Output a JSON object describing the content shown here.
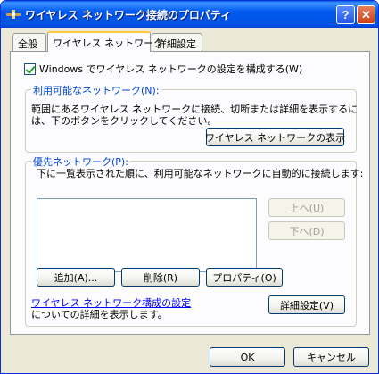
{
  "window": {
    "title": "ワイヤレス ネットワーク接続のプロパティ",
    "help_label": "?",
    "close_label": "✕"
  },
  "tabs": [
    {
      "label": "全般",
      "active": false
    },
    {
      "label": "ワイヤレス ネットワーク",
      "active": true
    },
    {
      "label": "詳細設定",
      "active": false
    }
  ],
  "config_checkbox": {
    "label": "Windows でワイヤレス ネットワークの設定を構成する(W)",
    "checked": true
  },
  "available": {
    "title": "利用可能なネットワーク(N):",
    "description_line1": "範囲にあるワイヤレス ネットワークに接続、切断または詳細を表示するに",
    "description_line2": "は、下のボタンをクリックしてください。",
    "view_button": "ワイヤレス ネットワークの表示"
  },
  "preferred": {
    "title": "優先ネットワーク(P):",
    "description": "下に一覧表示された順に、利用可能なネットワークに自動的に接続します:",
    "up_button": "上へ(U)",
    "down_button": "下へ(D)",
    "add_button": "追加(A)...",
    "remove_button": "削除(R)",
    "properties_button": "プロパティ(O)",
    "link_text": "ワイヤレス ネットワーク構成の設定",
    "link_desc": "についての詳細を表示します。",
    "advanced_button": "詳細設定(V)"
  },
  "footer": {
    "ok_label": "OK",
    "cancel_label": "キャンセル"
  },
  "colors": {
    "titlebar": "#0054e3",
    "dialog_bg": "#ece9d8",
    "group_label": "#0046d5",
    "link": "#0000ff",
    "active_tab_accent": "#ffc83c"
  }
}
